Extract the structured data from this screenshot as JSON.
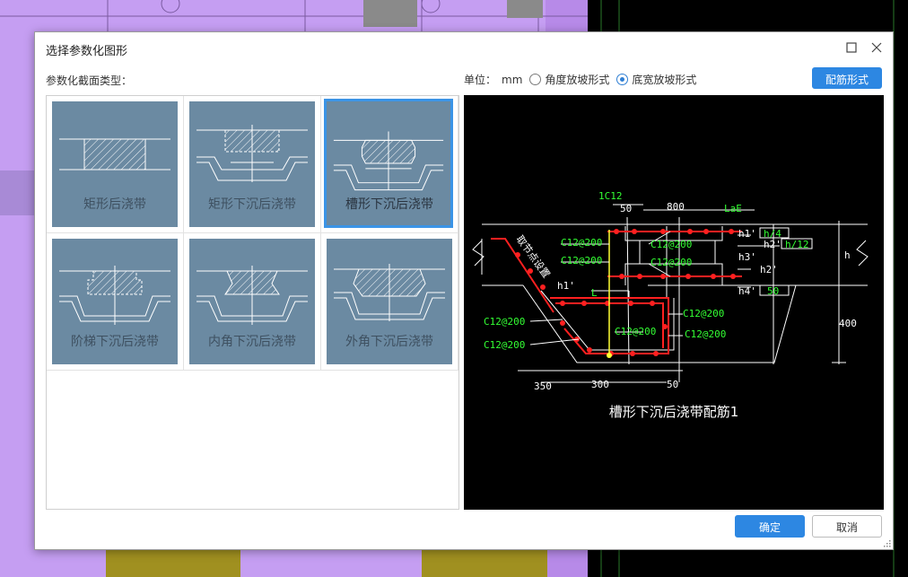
{
  "window": {
    "title": "选择参数化图形"
  },
  "section_label": "参数化截面类型：",
  "unit": {
    "label": "单位：",
    "value": "mm"
  },
  "slope_mode": {
    "options": [
      {
        "label": "角度放坡形式",
        "checked": false
      },
      {
        "label": "底宽放坡形式",
        "checked": true
      }
    ]
  },
  "buttons": {
    "rebar": "配筋形式",
    "ok": "确定",
    "cancel": "取消"
  },
  "shapes": [
    {
      "label": "矩形后浇带",
      "selected": false
    },
    {
      "label": "矩形下沉后浇带",
      "selected": false
    },
    {
      "label": "槽形下沉后浇带",
      "selected": true
    },
    {
      "label": "阶梯下沉后浇带",
      "selected": false
    },
    {
      "label": "内角下沉后浇带",
      "selected": false
    },
    {
      "label": "外角下沉后浇带",
      "selected": false
    }
  ],
  "preview": {
    "caption": "槽形下沉后浇带配筋1",
    "labels": {
      "top_bar": "1C12",
      "dim_50_left": "50",
      "dim_800": "800",
      "lae": "LaE",
      "h1_top": "h1'",
      "h4_box": "h/4",
      "h2_top": "h2'",
      "h12_box": "h/12",
      "h3": "h3'",
      "h2_mid": "h2'",
      "h4": "h4'",
      "box_50": "50",
      "h": "h",
      "dim_400": "400",
      "c12_a": "C12@200",
      "c12_b": "C12@200",
      "c12_c": "C12@200",
      "c12_d": "C12@200",
      "c12_e": "C12@200",
      "c12_f": "C12@200",
      "c12_g": "C12@200",
      "c12_h": "C12@200",
      "c12_i": "C12@200",
      "h1_mid": "h1'",
      "L": "L",
      "dim_350": "350",
      "dim_300": "300",
      "dim_50_bottom": "50",
      "slope_note": "取节点设置"
    }
  },
  "colors": {
    "accent": "#2d87e2",
    "thumb_bg": "#6b8aa2",
    "selection_border": "#3b94e6",
    "rebar_red": "#ff2020",
    "cad_green": "#33ff33",
    "cad_yellow": "#ffff33"
  }
}
